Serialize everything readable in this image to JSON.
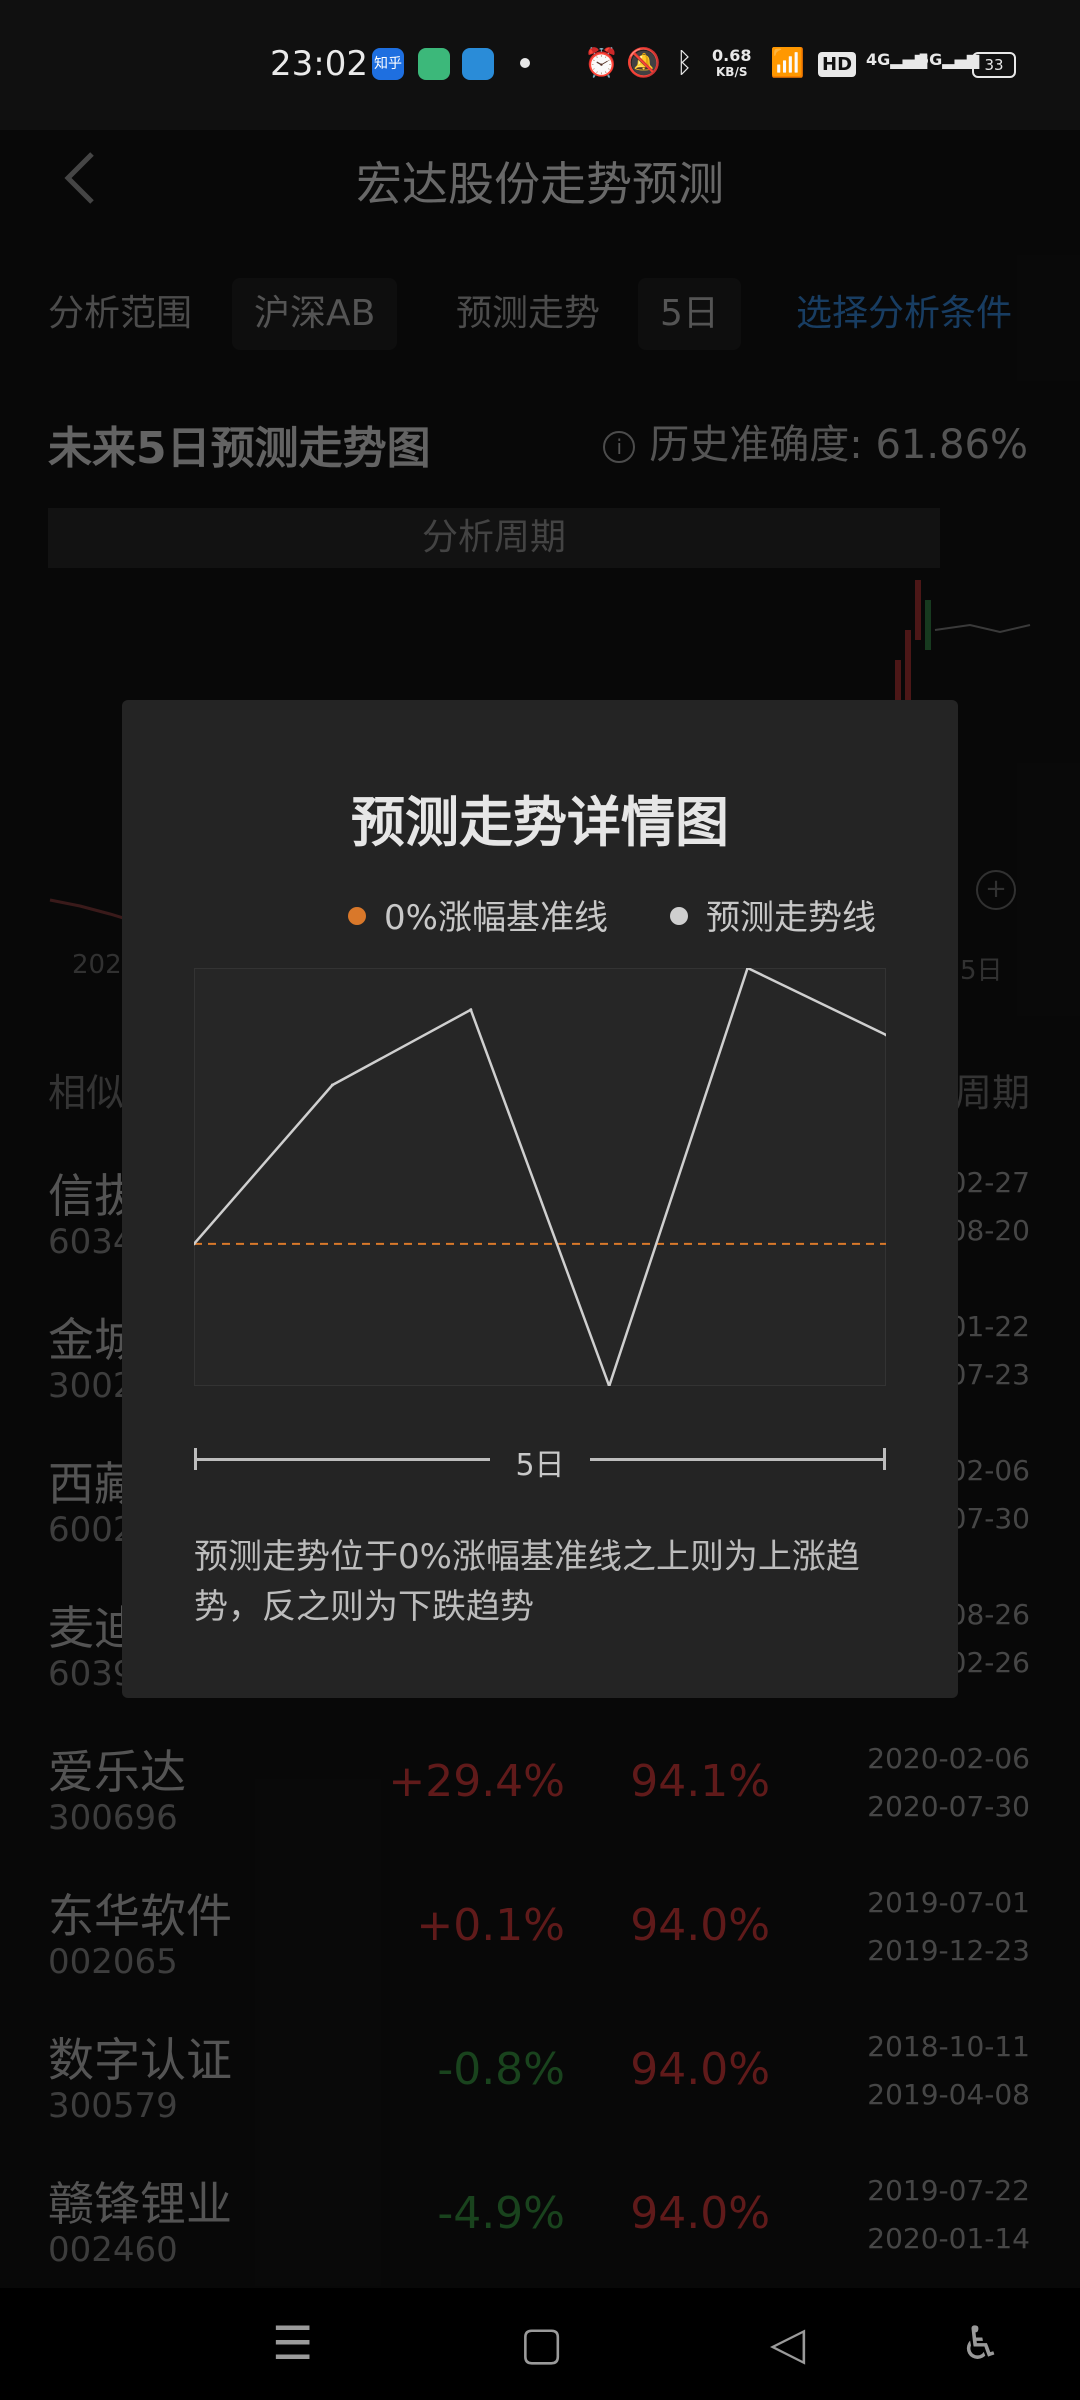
{
  "status_bar": {
    "time": "23:02",
    "apps": [
      "知乎",
      "books-icon",
      "browser-icon"
    ],
    "network_speed_value": "0.68",
    "network_speed_unit": "KB/S",
    "hd_label": "HD",
    "signal_1": "4G",
    "signal_2": "5G",
    "battery": "33"
  },
  "header": {
    "back_icon": "chevron-left-icon",
    "title": "宏达股份走势预测"
  },
  "filters": {
    "range_label": "分析范围",
    "range_value": "沪深AB",
    "trend_label": "预测走势",
    "trend_value": "5日",
    "select_link": "选择分析条件"
  },
  "forecast": {
    "title": "未来5日预测走势图",
    "accuracy_label": "历史准确度:",
    "accuracy_value": "61.86%",
    "period_bar": "分析周期",
    "x_start": "2021",
    "x_end": "5日"
  },
  "list": {
    "head_left": "相似",
    "head_right": "周期",
    "rows": [
      {
        "name": "信拔",
        "code": "6034",
        "change": "",
        "similarity": "",
        "date1": "02-27",
        "date2": "08-20",
        "dir": "up"
      },
      {
        "name": "金城",
        "code": "3002",
        "change": "",
        "similarity": "",
        "date1": "01-22",
        "date2": "07-23",
        "dir": "up"
      },
      {
        "name": "西藏",
        "code": "6002",
        "change": "",
        "similarity": "",
        "date1": "02-06",
        "date2": "07-30",
        "dir": "up"
      },
      {
        "name": "麦迪",
        "code": "6039",
        "change": "",
        "similarity": "",
        "date1": "08-26",
        "date2": "02-26",
        "dir": "up"
      },
      {
        "name": "爱乐达",
        "code": "300696",
        "change": "+29.4%",
        "similarity": "94.1%",
        "date1": "2020-02-06",
        "date2": "2020-07-30",
        "dir": "up"
      },
      {
        "name": "东华软件",
        "code": "002065",
        "change": "+0.1%",
        "similarity": "94.0%",
        "date1": "2019-07-01",
        "date2": "2019-12-23",
        "dir": "up"
      },
      {
        "name": "数字认证",
        "code": "300579",
        "change": "-0.8%",
        "similarity": "94.0%",
        "date1": "2018-10-11",
        "date2": "2019-04-08",
        "dir": "down"
      },
      {
        "name": "赣锋锂业",
        "code": "002460",
        "change": "-4.9%",
        "similarity": "94.0%",
        "date1": "2019-07-22",
        "date2": "2020-01-14",
        "dir": "down"
      }
    ]
  },
  "modal": {
    "title": "预测走势详情图",
    "legend_baseline": "0%涨幅基准线",
    "legend_forecast": "预测走势线",
    "period_label": "5日",
    "note": "预测走势位于0%涨幅基准线之上则为上涨趋势，反之则为下跌趋势",
    "colors": {
      "baseline": "#d9782a",
      "forecast": "#cfcfcf"
    }
  },
  "chart_data": {
    "type": "line",
    "x": [
      0,
      1,
      2,
      3,
      4,
      5
    ],
    "series": [
      {
        "name": "预测走势线",
        "values": [
          0,
          0.38,
          0.56,
          -0.34,
          0.66,
          0.5
        ]
      },
      {
        "name": "0%涨幅基准线",
        "values": [
          0,
          0,
          0,
          0,
          0,
          0
        ]
      }
    ],
    "ylim": [
      -0.34,
      0.66
    ],
    "xlabel": "5日",
    "grid": false
  },
  "navbar": {
    "icons": [
      "menu-icon",
      "home-icon",
      "back-triangle-icon",
      "accessibility-icon"
    ]
  }
}
